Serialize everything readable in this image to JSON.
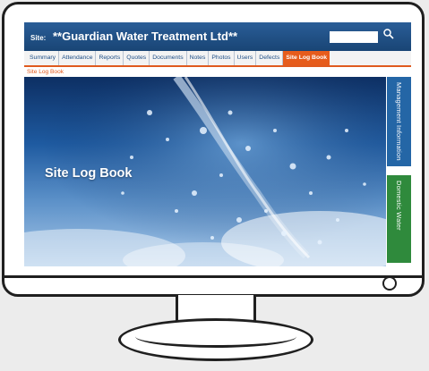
{
  "header": {
    "site_label": "Site:",
    "site_name": "**Guardian Water Treatment Ltd**",
    "search": {
      "value": "",
      "placeholder": ""
    }
  },
  "tabs": [
    {
      "label": "Summary"
    },
    {
      "label": "Attendance"
    },
    {
      "label": "Reports"
    },
    {
      "label": "Quotes"
    },
    {
      "label": "Documents"
    },
    {
      "label": "Notes"
    },
    {
      "label": "Photos"
    },
    {
      "label": "Users"
    },
    {
      "label": "Defects"
    },
    {
      "label": "Site Log Book",
      "active": true
    }
  ],
  "breadcrumb": "Site Log Book",
  "hero": {
    "title": "Site Log Book"
  },
  "side_tabs": {
    "management": "Management Information",
    "domestic": "Domestic Water"
  },
  "colors": {
    "header_blue": "#1e4e86",
    "active_tab": "#e65c1c",
    "management_tab": "#2466a6",
    "domestic_tab": "#2f8a3c"
  }
}
